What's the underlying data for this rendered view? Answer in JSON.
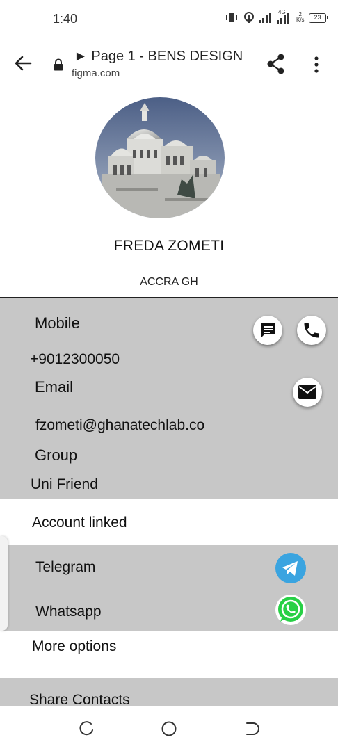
{
  "status_bar": {
    "time": "1:40",
    "network_label": "4G",
    "speed_value": "2",
    "speed_unit": "K/s",
    "battery": "23"
  },
  "browser": {
    "title": "► Page 1 - BENS DESIGN",
    "url": "figma.com"
  },
  "profile": {
    "name": "FREDA ZOMETI",
    "location": "ACCRA GH"
  },
  "details": {
    "mobile_label": "Mobile",
    "mobile_value": "+9012300050",
    "email_label": "Email",
    "email_value": "fzometi@ghanatechlab.co",
    "group_label": "Group",
    "group_value": "Uni Friend"
  },
  "accounts": {
    "title": "Account linked",
    "items": [
      {
        "label": "Telegram",
        "icon": "telegram-icon"
      },
      {
        "label": "Whatsapp",
        "icon": "whatsapp-icon"
      }
    ]
  },
  "more_options_label": "More options",
  "share_contacts_label": "Share Contacts",
  "colors": {
    "panel_gray": "#c7c7c7",
    "telegram_blue": "#3aa4e0",
    "whatsapp_green": "#27d045"
  }
}
